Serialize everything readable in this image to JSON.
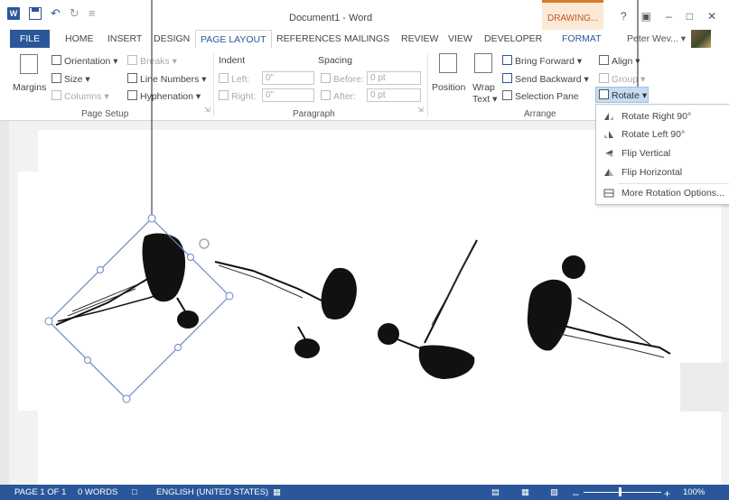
{
  "window": {
    "title": "Document1 - Word",
    "contextual_tab": "DRAWING...",
    "help_glyph": "?",
    "controls": [
      "▣",
      "–",
      "□",
      "✕"
    ]
  },
  "quick_access": {
    "word_logo": "W",
    "undo_glyph": "↶",
    "redo_glyph": "↻",
    "customize_glyph": "≡"
  },
  "tabs": [
    {
      "label": "FILE"
    },
    {
      "label": "HOME"
    },
    {
      "label": "INSERT"
    },
    {
      "label": "DESIGN"
    },
    {
      "label": "PAGE LAYOUT"
    },
    {
      "label": "REFERENCES"
    },
    {
      "label": "MAILINGS"
    },
    {
      "label": "REVIEW"
    },
    {
      "label": "VIEW"
    },
    {
      "label": "DEVELOPER"
    },
    {
      "label": "FORMAT"
    }
  ],
  "user": {
    "name": "Peter Wev... ▾"
  },
  "ribbon": {
    "page_setup": {
      "margins": "Margins",
      "orientation": "Orientation ▾",
      "size": "Size ▾",
      "columns": "Columns ▾",
      "breaks": "Breaks ▾",
      "line_numbers": "Line Numbers ▾",
      "hyphenation": "Hyphenation ▾",
      "label": "Page Setup"
    },
    "paragraph": {
      "indent_header": "Indent",
      "spacing_header": "Spacing",
      "left_label": "Left:",
      "right_label": "Right:",
      "before_label": "Before:",
      "after_label": "After:",
      "left_value": "0\"",
      "right_value": "0\"",
      "before_value": "0 pt",
      "after_value": "0 pt",
      "label": "Paragraph"
    },
    "arrange": {
      "position": "Position",
      "wrap_text_1": "Wrap",
      "wrap_text_2": "Text ▾",
      "bring_forward": "Bring Forward ▾",
      "send_backward": "Send Backward ▾",
      "selection_pane": "Selection Pane",
      "align": "Align ▾",
      "group": "Group ▾",
      "rotate": "Rotate ▾",
      "label": "Arrange"
    }
  },
  "rotate_menu": {
    "items": [
      {
        "label": "Rotate Right 90°"
      },
      {
        "label": "Rotate Left 90°"
      },
      {
        "label": "Flip Vertical"
      },
      {
        "label": "Flip Horizontal"
      },
      {
        "label": "More Rotation Options..."
      }
    ]
  },
  "status_bar": {
    "page": "PAGE 1 OF 1",
    "words": "0 WORDS",
    "language": "ENGLISH (UNITED STATES)",
    "zoom": "100%",
    "zoom_minus": "–",
    "zoom_plus": "+"
  },
  "colors": {
    "accent": "#2b579a",
    "contextual": "#c0581b",
    "selection": "#6c86c4"
  }
}
